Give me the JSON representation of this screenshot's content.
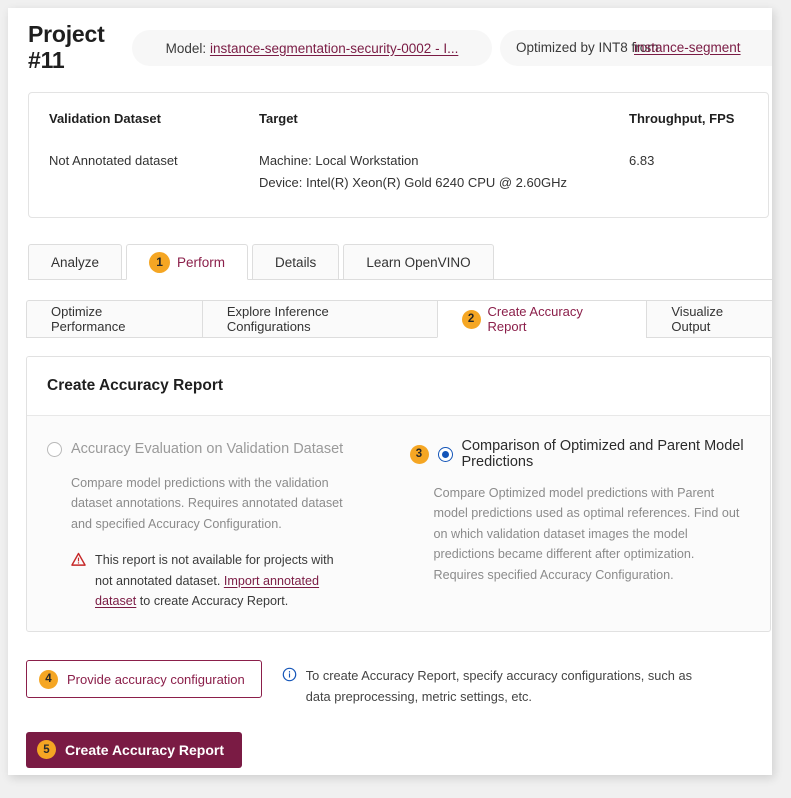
{
  "header": {
    "project_title": "Project #11",
    "model_prefix": "Model:",
    "model_name": "instance-segmentation-security-0002 - I...",
    "optimized_label": "Optimized by INT8 from",
    "parent_model_name": "instance-segment"
  },
  "summary": {
    "col1_header": "Validation Dataset",
    "col1_value": "Not Annotated dataset",
    "col2_header": "Target",
    "col2_machine": "Machine: Local Workstation",
    "col2_device": "Device: Intel(R) Xeon(R) Gold 6240 CPU @ 2.60GHz",
    "col3_header": "Throughput, FPS",
    "col3_value": "6.83"
  },
  "tabs": [
    {
      "label": "Analyze",
      "badge": "",
      "active": false
    },
    {
      "label": "Perform",
      "badge": "1",
      "active": true
    },
    {
      "label": "Details",
      "badge": "",
      "active": false
    },
    {
      "label": "Learn OpenVINO",
      "badge": "",
      "active": false
    }
  ],
  "subtabs": [
    {
      "label": "Optimize Performance",
      "badge": "",
      "active": false
    },
    {
      "label": "Explore Inference Configurations",
      "badge": "",
      "active": false
    },
    {
      "label": "Create Accuracy Report",
      "badge": "2",
      "active": true
    },
    {
      "label": "Visualize Output",
      "badge": "",
      "active": false
    }
  ],
  "panel": {
    "title": "Create Accuracy Report",
    "option_left": {
      "badge": "",
      "label": "Accuracy Evaluation on Validation Dataset",
      "selected": false,
      "description": "Compare model predictions with the validation dataset annotations. Requires annotated dataset and specified Accuracy Configuration.",
      "warning_text_1": "This report is not available for projects with not annotated dataset. ",
      "warning_link": "Import annotated dataset",
      "warning_text_2": " to create Accuracy Report."
    },
    "option_right": {
      "badge": "3",
      "label": "Comparison of Optimized and Parent Model Predictions",
      "selected": true,
      "description": "Compare Optimized model predictions with Parent model predictions used as optimal references. Find out on which validation dataset images the model predictions became different after optimization. Requires specified Accuracy Configuration."
    }
  },
  "actions": {
    "provide_config_badge": "4",
    "provide_config_label": "Provide accuracy configuration",
    "hint_text": "To create Accuracy Report, specify accuracy configurations, such as data preprocessing, metric settings, etc.",
    "create_report_badge": "5",
    "create_report_label": "Create Accuracy Report"
  },
  "colors": {
    "brand": "#7a1b44",
    "badge": "#f5a623",
    "radio_selected": "#1455b8",
    "warning": "#c62828",
    "info": "#1455b8"
  }
}
